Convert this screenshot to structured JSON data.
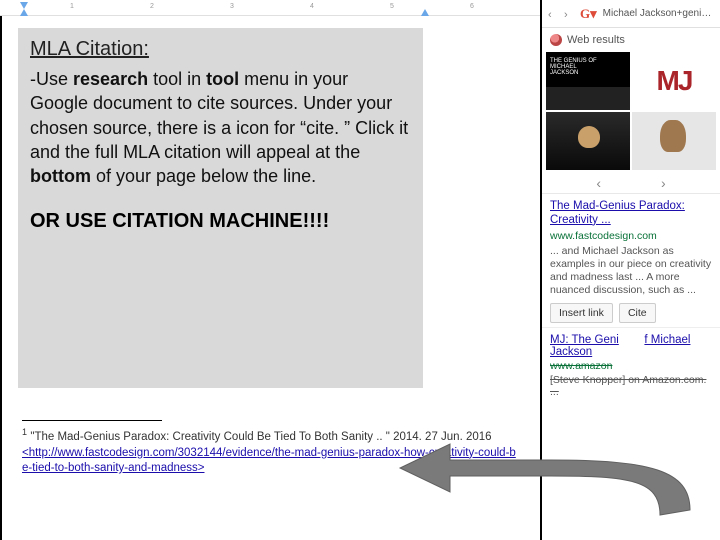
{
  "callout": {
    "title": "MLA Citation:",
    "body_prefix": "-Use ",
    "b1": "research",
    "body_mid1": " tool in ",
    "b2": "tool",
    "body_mid2": " menu in your Google document to cite sources.  Under your chosen source, there is a icon for “cite. ” Click it and the full MLA citation will appeal at the ",
    "b3": "bottom",
    "body_suffix": " of your page below the line.",
    "or_line": "OR USE CITATION MACHINE!!!!"
  },
  "footnote": {
    "sup": "1",
    "title": " \"The Mad-Genius Paradox: Creativity Could Be Tied To Both Sanity .. \" 2014. 27 Jun. 2016",
    "url": "<http://www.fastcodesign.com/3032144/evidence/the-mad-genius-paradox-how-creativity-could-be-tied-to-both-sanity-and-madness>"
  },
  "sidebar": {
    "search_text": "Michael Jackson+genius+ma",
    "tab_label": "Web results",
    "img_b_text": "MJ",
    "img_a_line1": "THE GENIUS OF",
    "img_a_line2": "MICHAEL",
    "img_a_line3": "JACKSON",
    "pager_left": "‹",
    "pager_right": "›",
    "result1": {
      "title": "The Mad-Genius Paradox: Creativity ...",
      "url": "www.fastcodesign.com",
      "snippet": "... and Michael Jackson as examples in our piece on creativity and madness last ... A more nuanced discussion, such as ...",
      "btn_insert": "Insert link",
      "btn_cite": "Cite"
    },
    "result2": {
      "title_a": "MJ: The Geni",
      "title_b": "f Michael Jackson",
      "url": "www.amazon",
      "snippet": "[Steve Knopper] on Amazon.com. ..."
    }
  },
  "ruler_marks": [
    "1",
    "2",
    "3",
    "4",
    "5",
    "6"
  ]
}
